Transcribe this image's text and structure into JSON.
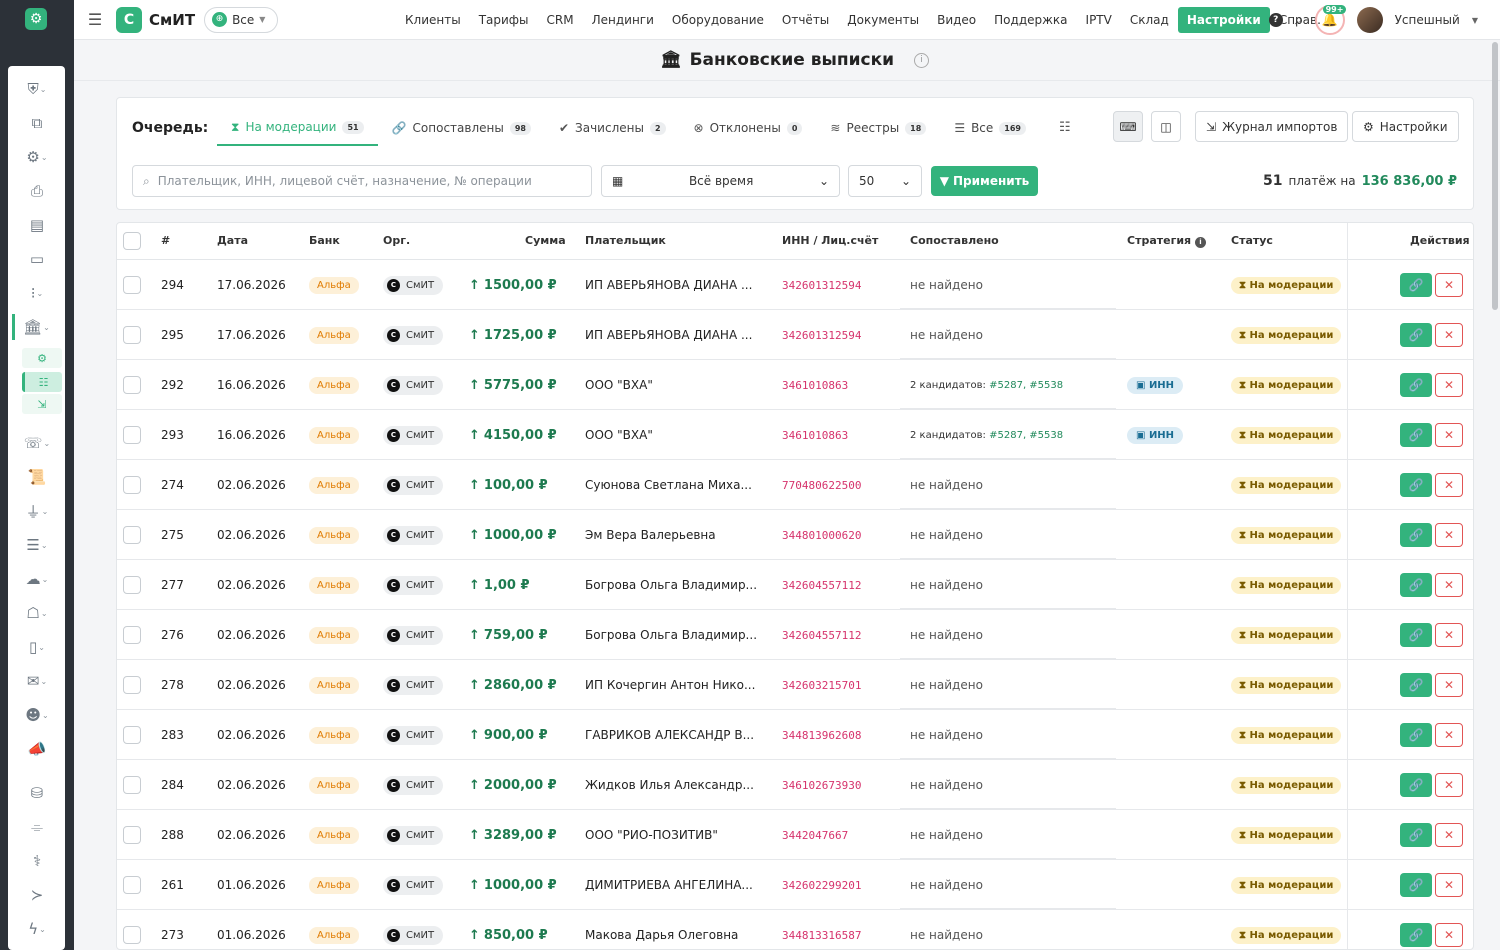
{
  "app": {
    "brand": "СмИТ",
    "scope": "Все",
    "title": "Банковские выписки",
    "user": "Успешный",
    "notif_count": "99+"
  },
  "nav": [
    "Клиенты",
    "Тарифы",
    "CRM",
    "Лендинги",
    "Оборудование",
    "Отчёты",
    "Документы",
    "Видео",
    "Поддержка",
    "IPTV",
    "Склад",
    "Настройки",
    "Справ."
  ],
  "queue_label": "Очередь:",
  "tabs": [
    {
      "label": "На модерации",
      "count": "51",
      "icon": "hourglass-icon",
      "glyph": "⧗"
    },
    {
      "label": "Сопоставлены",
      "count": "98",
      "icon": "link-icon",
      "glyph": "🔗"
    },
    {
      "label": "Зачислены",
      "count": "2",
      "icon": "check-circle-icon",
      "glyph": "✔"
    },
    {
      "label": "Отклонены",
      "count": "0",
      "icon": "x-circle-icon",
      "glyph": "⊗"
    },
    {
      "label": "Реестры",
      "count": "18",
      "icon": "layers-icon",
      "glyph": "≋"
    },
    {
      "label": "Все",
      "count": "169",
      "icon": "list-icon",
      "glyph": "☰"
    }
  ],
  "toolbar": {
    "import_journal": "Журнал импортов",
    "settings": "Настройки"
  },
  "filters": {
    "search_placeholder": "Плательщик, ИНН, лицевой счёт, назначение, № операции",
    "period": "Всё время",
    "per_page": "50",
    "apply": "Применить"
  },
  "summary": {
    "count": "51",
    "mid": "платёж на",
    "amount": "136 836,00 ₽"
  },
  "columns": {
    "num": "#",
    "date": "Дата",
    "bank": "Банк",
    "org": "Орг.",
    "sum": "Сумма",
    "payer": "Плательщик",
    "inn": "ИНН / Лиц.счёт",
    "matched": "Сопоставлено",
    "strategy": "Стратегия",
    "status": "Статус",
    "actions": "Действия"
  },
  "org_label": "СмИТ",
  "bank_label": "Альфа",
  "status_label": "На модерации",
  "rows": [
    {
      "id": "294",
      "date": "17.06.2026",
      "amount": "1500,00 ₽",
      "payer": "ИП АВЕРЬЯНОВА ДИАНА ...",
      "inn": "342601312594",
      "match": "не найдено",
      "strategy": ""
    },
    {
      "id": "295",
      "date": "17.06.2026",
      "amount": "1725,00 ₽",
      "payer": "ИП АВЕРЬЯНОВА ДИАНА ...",
      "inn": "342601312594",
      "match": "не найдено",
      "strategy": ""
    },
    {
      "id": "292",
      "date": "16.06.2026",
      "amount": "5775,00 ₽",
      "payer": "ООО \"ВХА\"",
      "inn": "3461010863",
      "match": "",
      "cands": "2 кандидатов:",
      "links": "#5287, #5538",
      "strategy": "ИНН"
    },
    {
      "id": "293",
      "date": "16.06.2026",
      "amount": "4150,00 ₽",
      "payer": "ООО \"ВХА\"",
      "inn": "3461010863",
      "match": "",
      "cands": "2 кандидатов:",
      "links": "#5287, #5538",
      "strategy": "ИНН"
    },
    {
      "id": "274",
      "date": "02.06.2026",
      "amount": "100,00 ₽",
      "payer": "Суюнова Светлана Миха...",
      "inn": "770480622500",
      "match": "не найдено",
      "strategy": ""
    },
    {
      "id": "275",
      "date": "02.06.2026",
      "amount": "1000,00 ₽",
      "payer": "Эм Вера Валерьевна",
      "inn": "344801000620",
      "match": "не найдено",
      "strategy": ""
    },
    {
      "id": "277",
      "date": "02.06.2026",
      "amount": "1,00 ₽",
      "payer": "Богрова Ольга Владимир...",
      "inn": "342604557112",
      "match": "не найдено",
      "strategy": ""
    },
    {
      "id": "276",
      "date": "02.06.2026",
      "amount": "759,00 ₽",
      "payer": "Богрова Ольга Владимир...",
      "inn": "342604557112",
      "match": "не найдено",
      "strategy": ""
    },
    {
      "id": "278",
      "date": "02.06.2026",
      "amount": "2860,00 ₽",
      "payer": "ИП Кочергин Антон Нико...",
      "inn": "342603215701",
      "match": "не найдено",
      "strategy": ""
    },
    {
      "id": "283",
      "date": "02.06.2026",
      "amount": "900,00 ₽",
      "payer": "ГАВРИКОВ АЛЕКСАНДР В...",
      "inn": "344813962608",
      "match": "не найдено",
      "strategy": ""
    },
    {
      "id": "284",
      "date": "02.06.2026",
      "amount": "2000,00 ₽",
      "payer": "Жидков Илья Александр...",
      "inn": "346102673930",
      "match": "не найдено",
      "strategy": ""
    },
    {
      "id": "288",
      "date": "02.06.2026",
      "amount": "3289,00 ₽",
      "payer": "ООО \"РИО-ПОЗИТИВ\"",
      "inn": "3442047667",
      "match": "не найдено",
      "strategy": ""
    },
    {
      "id": "261",
      "date": "01.06.2026",
      "amount": "1000,00 ₽",
      "payer": "ДИМИТРИЕВА АНГЕЛИНА...",
      "inn": "342602299201",
      "match": "не найдено",
      "strategy": ""
    },
    {
      "id": "273",
      "date": "01.06.2026",
      "amount": "850,00 ₽",
      "payer": "Макова Дарья Олеговна",
      "inn": "344813316587",
      "match": "не найдено",
      "strategy": ""
    }
  ],
  "rail_icons": [
    {
      "name": "shield-icon",
      "g": "⛨",
      "chev": true
    },
    {
      "name": "network-icon",
      "g": "⧉",
      "chev": false
    },
    {
      "name": "gears-icon",
      "g": "⚙",
      "chev": true
    },
    {
      "name": "printer-icon",
      "g": "⎙",
      "chev": false
    },
    {
      "name": "cash-register-icon",
      "g": "▤",
      "chev": false
    },
    {
      "name": "card-icon",
      "g": "▭",
      "chev": false
    },
    {
      "name": "traffic-light-icon",
      "g": "⁝",
      "chev": true
    },
    {
      "name": "bank-icon",
      "g": "🏛",
      "chev": true
    },
    {
      "name": "phone-icon",
      "g": "☏",
      "chev": true
    },
    {
      "name": "scroll-icon",
      "g": "📜",
      "chev": false
    },
    {
      "name": "plug-icon",
      "g": "⏚",
      "chev": true
    },
    {
      "name": "server-icon",
      "g": "☰",
      "chev": true
    },
    {
      "name": "cloud-icon",
      "g": "☁",
      "chev": true
    },
    {
      "name": "robot-icon",
      "g": "☖",
      "chev": true
    },
    {
      "name": "mobile-icon",
      "g": "▯",
      "chev": true
    },
    {
      "name": "envelope-icon",
      "g": "✉",
      "chev": true
    },
    {
      "name": "users-icon",
      "g": "☻",
      "chev": true
    },
    {
      "name": "bullhorn-icon",
      "g": "📣",
      "chev": false
    },
    {
      "name": "database-icon",
      "g": "⛁",
      "chev": false
    },
    {
      "name": "broom-icon",
      "g": "⌯",
      "chev": false
    },
    {
      "name": "stethoscope-icon",
      "g": "⚕",
      "chev": false
    },
    {
      "name": "terminal-icon",
      "g": "≻",
      "chev": false
    },
    {
      "name": "bolt-icon",
      "g": "ϟ",
      "chev": true
    }
  ],
  "bank_submenu": [
    {
      "name": "bank-settings-icon",
      "g": "⚙"
    },
    {
      "name": "bank-statements-icon",
      "g": "☷"
    },
    {
      "name": "bank-import-icon",
      "g": "⇲"
    }
  ],
  "colors": {
    "accent": "#33b37d",
    "inn": "#d6336c",
    "amount": "#1d7a4f",
    "bank_badge": "#fdf0d8",
    "status_badge": "#fdf1c9"
  }
}
